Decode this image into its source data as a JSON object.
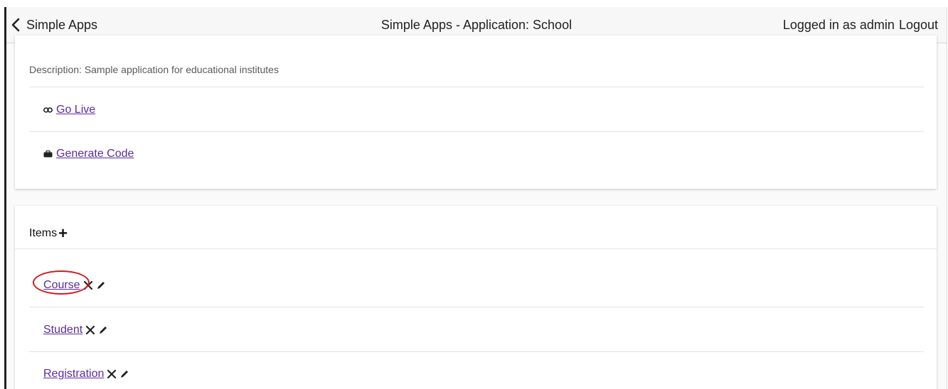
{
  "topbar": {
    "back_label": "Simple Apps",
    "title": "Simple Apps - Application: School",
    "logged_in_text": "Logged in as admin",
    "logout_label": "Logout"
  },
  "app_card": {
    "description": "Description: Sample application for educational institutes",
    "go_live_label": "Go Live",
    "generate_code_label": "Generate Code",
    "go_live_icon": "link-icon",
    "generate_code_icon": "briefcase-icon"
  },
  "items_card": {
    "header": "Items",
    "add_icon": "plus-icon",
    "items": [
      {
        "label": "Course",
        "highlighted": true
      },
      {
        "label": "Student",
        "highlighted": false
      },
      {
        "label": "Registration",
        "highlighted": false
      }
    ]
  },
  "colors": {
    "link": "#5a2ca0",
    "highlight_ring": "#d11a1a"
  }
}
